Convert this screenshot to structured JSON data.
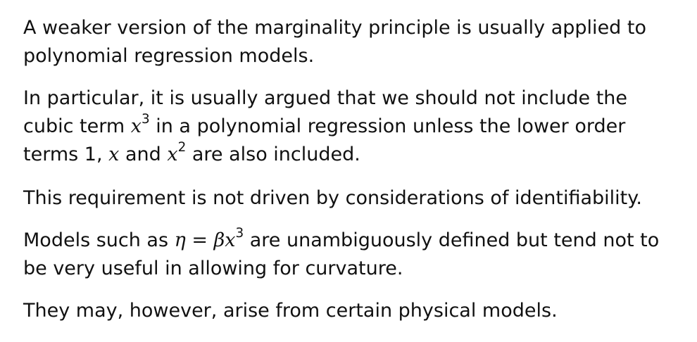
{
  "paragraphs": {
    "p1": {
      "line1": "A weaker version of the marginality principle is usually applied to",
      "line2": "polynomial regression models."
    },
    "p2": {
      "line1_pre": "In particular, it is usually argued that we should not include the",
      "line2_pre": "cubic term ",
      "line2_var": "x",
      "line2_exp": "3",
      "line2_post": " in a polynomial regression unless the lower order",
      "line3_pre": "terms 1, ",
      "line3_var1": "x",
      "line3_mid": " and ",
      "line3_var2": "x",
      "line3_exp": "2",
      "line3_post": " are also included."
    },
    "p3": {
      "line1": "This requirement is not driven by considerations of identifiability."
    },
    "p4": {
      "line1_pre": "Models such as ",
      "eta": "η",
      "equals": " = ",
      "beta": "β",
      "var": "x",
      "exp": "3",
      "line1_post": " are unambiguously defined but tend not to",
      "line2": "be very useful in allowing for curvature."
    },
    "p5": {
      "line1": "They may, however, arise from certain physical models."
    }
  }
}
